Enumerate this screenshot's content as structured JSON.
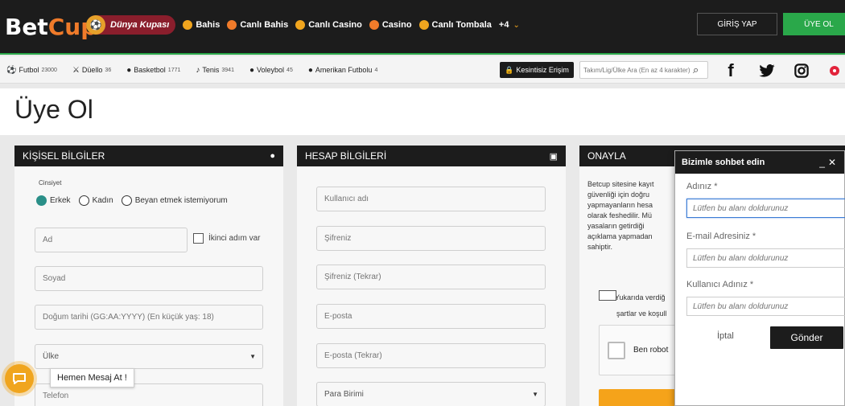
{
  "header": {
    "logo_a": "Bet",
    "logo_b": "Cup",
    "featured": "Dünya Kupası",
    "nav": [
      "Bahis",
      "Canlı Bahis",
      "Canlı Casino",
      "Casino",
      "Canlı Tombala"
    ],
    "more": "+4",
    "login": "GİRİŞ YAP",
    "register": "ÜYE OL",
    "accent": "#2aa84a"
  },
  "sports": [
    {
      "name": "Futbol",
      "count": "23000",
      "icon": "soccer-ball-icon"
    },
    {
      "name": "Düello",
      "count": "36",
      "icon": "duel-icon"
    },
    {
      "name": "Basketbol",
      "count": "1771",
      "icon": "basketball-icon"
    },
    {
      "name": "Tenis",
      "count": "3941",
      "icon": "tennis-icon"
    },
    {
      "name": "Voleybol",
      "count": "45",
      "icon": "volleyball-icon"
    },
    {
      "name": "Amerikan Futbolu",
      "count": "4",
      "icon": "helmet-icon"
    }
  ],
  "access": "Kesintisiz Erişim",
  "search_placeholder": "Takım/Lig/Ülke Ara (En az 4 karakter)",
  "page_title": "Üye Ol",
  "personal": {
    "header": "KİŞİSEL BİLGİLER",
    "gender_label": "Cinsiyet",
    "genders": [
      "Erkek",
      "Kadın",
      "Beyan etmek istemiyorum"
    ],
    "name": "Ad",
    "second_name": "İkinci adım var",
    "surname": "Soyad",
    "birthdate": "Doğum tarihi (GG:AA:YYYY) (En küçük yaş: 18)",
    "country": "Ülke",
    "phone": "Telefon"
  },
  "account": {
    "header": "HESAP BİLGİLERİ",
    "username": "Kullanıcı adı",
    "password": "Şifreniz",
    "password2": "Şifreniz (Tekrar)",
    "email": "E-posta",
    "email2": "E-posta (Tekrar)",
    "currency": "Para Birimi"
  },
  "confirm": {
    "header": "ONAYLA",
    "text_lines": [
      "Betcup sitesine kayıt",
      "güvenliği için doğru",
      "yapmayanların hesa",
      "olarak feshedilir. Mü",
      "yasaların getirdiği",
      "açıklama yapmadan",
      "sahiptir."
    ],
    "terms_1": "Yukarıda verdiğ",
    "terms_2": "şartlar ve koşull",
    "captcha": "Ben robot"
  },
  "chat": {
    "title": "Bizimle sohbet edin",
    "name_label": "Adınız *",
    "email_label": "E-mail Adresiniz *",
    "user_label": "Kullanıcı Adınız *",
    "placeholder": "Lütfen bu alanı doldurunuz",
    "cancel": "İptal",
    "send": "Gönder"
  },
  "message_prompt": "Hemen Mesaj At !"
}
